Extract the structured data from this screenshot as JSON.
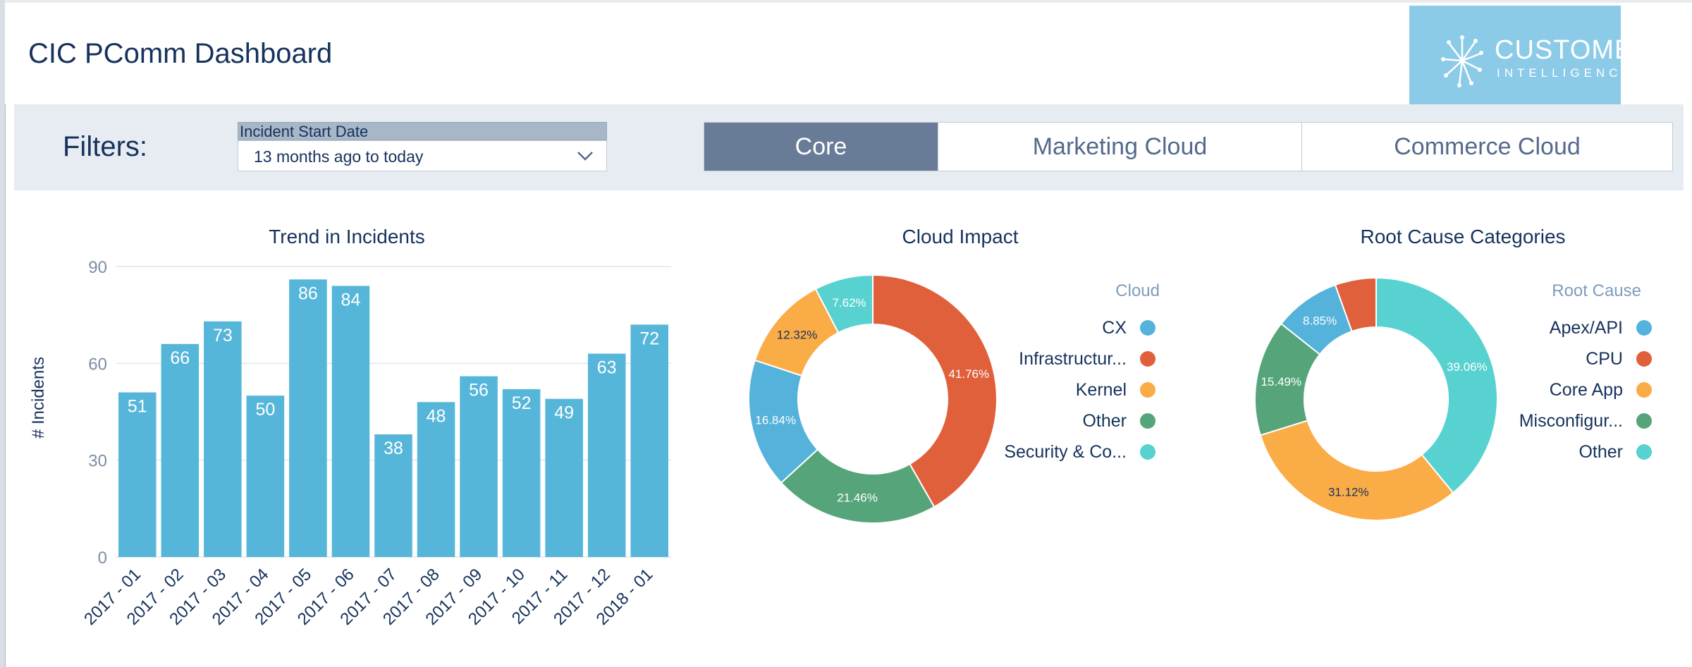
{
  "header": {
    "title": "CIC PComm Dashboard"
  },
  "logo": {
    "line1": "CUSTOMER",
    "line2": "INTELLIGENCE"
  },
  "filters": {
    "label": "Filters:",
    "date": {
      "label": "Incident Start Date",
      "value": "13 months ago to today"
    },
    "tabs": [
      {
        "label": "Core",
        "active": true
      },
      {
        "label": "Marketing Cloud",
        "active": false
      },
      {
        "label": "Commerce Cloud",
        "active": false
      }
    ]
  },
  "colors": {
    "bar": "#56b6d9",
    "cx": "#54b2db",
    "red": "#e1603c",
    "orange": "#faac47",
    "green": "#56a57a",
    "teal": "#57d2d1"
  },
  "chart_data": [
    {
      "type": "bar",
      "title": "Trend in Incidents",
      "ylabel": "# Incidents",
      "xlabel": "",
      "categories": [
        "2017 - 01",
        "2017 - 02",
        "2017 - 03",
        "2017 - 04",
        "2017 - 05",
        "2017 - 06",
        "2017 - 07",
        "2017 - 08",
        "2017 - 09",
        "2017 - 10",
        "2017 - 11",
        "2017 - 12",
        "2018 - 01"
      ],
      "values": [
        51,
        66,
        73,
        50,
        86,
        84,
        38,
        48,
        56,
        52,
        49,
        63,
        72
      ],
      "yticks": [
        0,
        30,
        60,
        90
      ],
      "ylim": [
        0,
        90
      ],
      "grid": true
    },
    {
      "type": "pie",
      "title": "Cloud Impact",
      "legend_title": "Cloud",
      "legend_position": "right",
      "slices": [
        {
          "label": "Infrastructur...",
          "value": 41.76,
          "value_label": "41.76%",
          "color": "#e1603c"
        },
        {
          "label": "Other",
          "value": 21.46,
          "value_label": "21.46%",
          "color": "#56a57a"
        },
        {
          "label": "CX",
          "value": 16.84,
          "value_label": "16.84%",
          "color": "#54b2db"
        },
        {
          "label": "Kernel",
          "value": 12.32,
          "value_label": "12.32%",
          "color": "#faac47"
        },
        {
          "label": "Security & Co...",
          "value": 7.62,
          "value_label": "7.62%",
          "color": "#57d2d1"
        }
      ],
      "legend": [
        {
          "label": "CX",
          "color": "#54b2db"
        },
        {
          "label": "Infrastructur...",
          "color": "#e1603c"
        },
        {
          "label": "Kernel",
          "color": "#faac47"
        },
        {
          "label": "Other",
          "color": "#56a57a"
        },
        {
          "label": "Security & Co...",
          "color": "#57d2d1"
        }
      ]
    },
    {
      "type": "pie",
      "title": "Root Cause Categories",
      "legend_title": "Root Cause",
      "legend_position": "right",
      "slices": [
        {
          "label": "Other",
          "value": 39.06,
          "value_label": "39.06%",
          "color": "#57d2d1"
        },
        {
          "label": "Core App",
          "value": 31.12,
          "value_label": "31.12%",
          "color": "#faac47"
        },
        {
          "label": "Misconfigur...",
          "value": 15.49,
          "value_label": "15.49%",
          "color": "#56a57a"
        },
        {
          "label": "Apex/API",
          "value": 8.85,
          "value_label": "8.85%",
          "color": "#54b2db"
        },
        {
          "label": "CPU",
          "value": 5.48,
          "value_label": "",
          "color": "#e1603c"
        }
      ],
      "legend": [
        {
          "label": "Apex/API",
          "color": "#54b2db"
        },
        {
          "label": "CPU",
          "color": "#e1603c"
        },
        {
          "label": "Core App",
          "color": "#faac47"
        },
        {
          "label": "Misconfigur...",
          "color": "#56a57a"
        },
        {
          "label": "Other",
          "color": "#57d2d1"
        }
      ]
    }
  ]
}
